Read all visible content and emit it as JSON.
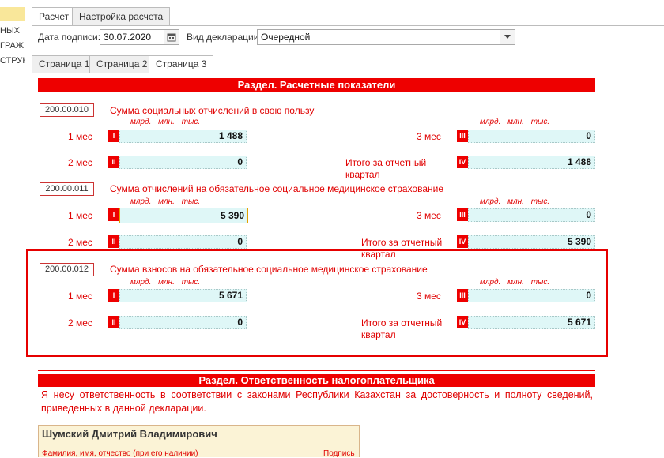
{
  "left_panel": {
    "items": [
      "НЫХ",
      "ГРАЖ",
      "СТРУК"
    ]
  },
  "top_tabs": [
    "Расчет",
    "Настройка расчета"
  ],
  "header": {
    "sign_date_label": "Дата подписи:",
    "sign_date_value": "30.07.2020",
    "decl_type_label": "Вид декларации:",
    "decl_type_value": "Очередной"
  },
  "page_tabs": [
    "Страница 1",
    "Страница 2",
    "Страница 3"
  ],
  "section1_title": "Раздел. Расчетные показатели",
  "units_label": "млрд. млн. тыс.",
  "labels": {
    "m1": "1 мес",
    "m2": "2 мес",
    "m3": "3 мес",
    "total": "Итого за отчетный квартал"
  },
  "romans": [
    "I",
    "II",
    "III",
    "IV"
  ],
  "blocks": [
    {
      "code": "200.00.010",
      "title": "Сумма социальных отчислений в свою пользу",
      "m1": "1 488",
      "m2": "0",
      "m3": "0",
      "total": "1 488"
    },
    {
      "code": "200.00.011",
      "title": "Сумма отчислений на обязательное социальное медицинское страхование",
      "m1": "5 390",
      "m2": "0",
      "m3": "0",
      "total": "5 390"
    },
    {
      "code": "200.00.012",
      "title": "Сумма взносов на обязательное социальное медицинское страхование",
      "m1": "5 671",
      "m2": "0",
      "m3": "0",
      "total": "5 671"
    }
  ],
  "section2_title": "Раздел. Ответственность налогоплательщика",
  "responsibility_text": "Я несу ответственность в соответствии с законами Республики Казахстан за достоверность и полноту сведений, приведенных в данной декларации.",
  "signer": {
    "name": "Шумский Дмитрий Владимирович",
    "caption": "Фамилия, имя, отчество (при его наличии)",
    "sign_caption": "Подпись"
  },
  "colors": {
    "accent_red": "#ee0000",
    "field_bg": "#dff7f7",
    "highlight": "#e60000"
  }
}
